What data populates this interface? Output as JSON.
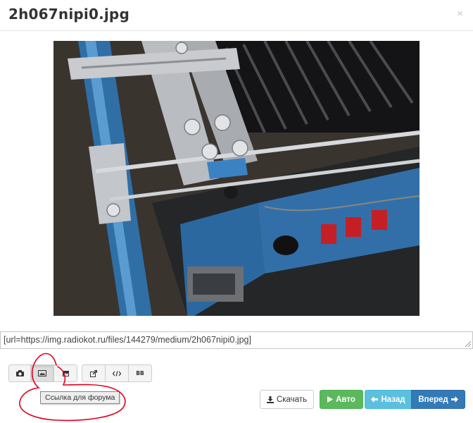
{
  "modal": {
    "title": "2h067nipi0.jpg",
    "close_glyph": "×"
  },
  "image": {
    "alt": "2h067nipi0.jpg"
  },
  "bbcode": {
    "value": "[url=https://img.radiokot.ru/files/144279/medium/2h067nipi0.jpg]"
  },
  "toolbar": {
    "buttons": [
      {
        "icon": "camera-icon"
      },
      {
        "icon": "image-icon"
      },
      {
        "icon": "thumbnail-icon"
      },
      {
        "icon": "external-link-icon"
      },
      {
        "icon": "code-icon"
      },
      {
        "icon": "bbcode-icon",
        "label": "BB"
      }
    ],
    "tooltip": "Ссылка для форума"
  },
  "actions": {
    "download_label": "Скачать",
    "auto_label": "Авто",
    "back_label": "Назад",
    "next_label": "Вперед"
  },
  "colors": {
    "auto": "#5cb85c",
    "back": "#5bc0de",
    "next": "#337ab7",
    "annotation": "#e0001b"
  }
}
